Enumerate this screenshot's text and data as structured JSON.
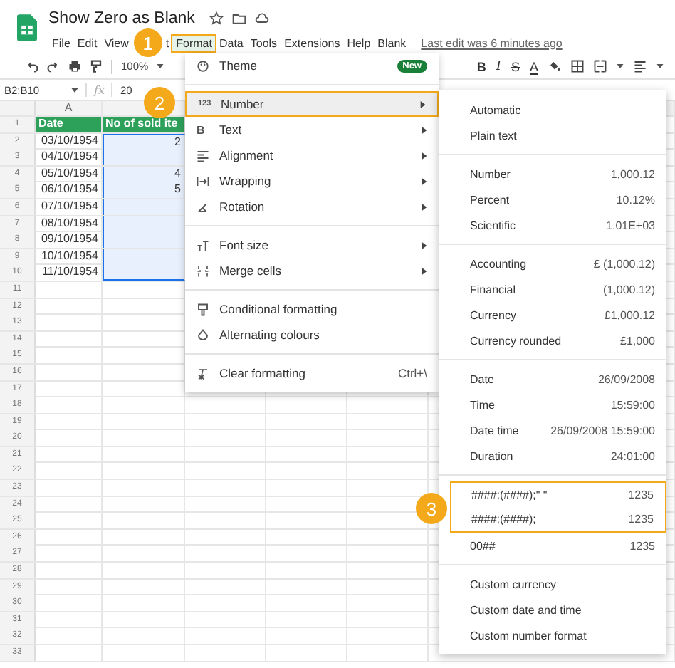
{
  "document": {
    "title": "Show Zero as Blank",
    "last_edit": "Last edit was 6 minutes ago"
  },
  "menu_bar": [
    {
      "label": "File",
      "selected": false
    },
    {
      "label": "Edit",
      "selected": false
    },
    {
      "label": "View",
      "selected": false
    },
    {
      "label": "t",
      "selected": false
    },
    {
      "label": "Format",
      "selected": true
    },
    {
      "label": "Data",
      "selected": false
    },
    {
      "label": "Tools",
      "selected": false
    },
    {
      "label": "Extensions",
      "selected": false
    },
    {
      "label": "Help",
      "selected": false
    },
    {
      "label": "Blank",
      "selected": false
    }
  ],
  "toolbar": {
    "zoom": "100%",
    "format_buttons": [
      "B",
      "I",
      "S",
      "A"
    ]
  },
  "formula_bar": {
    "range": "B2:B10",
    "fx": "fx",
    "value": "20"
  },
  "columns": [
    "A"
  ],
  "row_numbers": [
    "1",
    "2",
    "3",
    "4",
    "5",
    "6",
    "7",
    "8",
    "9",
    "10",
    "11",
    "12",
    "13",
    "14",
    "15",
    "16",
    "17",
    "18",
    "19",
    "20",
    "21",
    "22",
    "23",
    "24",
    "25",
    "26",
    "27",
    "28",
    "29",
    "30",
    "31",
    "32",
    "33"
  ],
  "rows": [
    {
      "header": true,
      "cells": [
        {
          "text": "Date",
          "selected": false
        },
        {
          "text": "No of sold ite",
          "selected": false
        }
      ]
    },
    {
      "header": false,
      "cells": [
        {
          "text": "03/10/1954",
          "selected": false
        },
        {
          "text": "2",
          "selected": true
        }
      ]
    },
    {
      "header": false,
      "cells": [
        {
          "text": "04/10/1954",
          "selected": false
        },
        {
          "selected": true
        }
      ]
    },
    {
      "header": false,
      "cells": [
        {
          "text": "05/10/1954",
          "selected": false
        },
        {
          "text": "4",
          "selected": true
        }
      ]
    },
    {
      "header": false,
      "cells": [
        {
          "text": "06/10/1954",
          "selected": false
        },
        {
          "text": "5",
          "selected": true
        }
      ]
    },
    {
      "header": false,
      "cells": [
        {
          "text": "07/10/1954",
          "selected": false
        },
        {
          "selected": true
        }
      ]
    },
    {
      "header": false,
      "cells": [
        {
          "text": "08/10/1954",
          "selected": false
        },
        {
          "selected": true
        }
      ]
    },
    {
      "header": false,
      "cells": [
        {
          "text": "09/10/1954",
          "selected": false
        },
        {
          "selected": true
        }
      ]
    },
    {
      "header": false,
      "cells": [
        {
          "text": "10/10/1954",
          "selected": false
        },
        {
          "selected": true
        }
      ]
    },
    {
      "header": false,
      "cells": [
        {
          "text": "11/10/1954",
          "selected": false
        },
        {
          "selected": true
        }
      ]
    }
  ],
  "format_menu": {
    "sections": [
      [
        {
          "label": "Theme",
          "badge": "New",
          "selected": false,
          "submenu": false
        }
      ],
      [
        {
          "label": "Number",
          "icon_text": "123",
          "selected": true,
          "submenu": true
        },
        {
          "label": "Text",
          "icon_text": "B",
          "selected": false,
          "submenu": true
        },
        {
          "label": "Alignment",
          "selected": false,
          "submenu": true
        },
        {
          "label": "Wrapping",
          "selected": false,
          "submenu": true
        },
        {
          "label": "Rotation",
          "selected": false,
          "submenu": true
        }
      ],
      [
        {
          "label": "Font size",
          "selected": false,
          "submenu": true
        },
        {
          "label": "Merge cells",
          "selected": false,
          "submenu": true
        }
      ],
      [
        {
          "label": "Conditional formatting",
          "selected": false,
          "submenu": false
        },
        {
          "label": "Alternating colours",
          "selected": false,
          "submenu": false
        }
      ],
      [
        {
          "label": "Clear formatting",
          "shortcut": "Ctrl+\\",
          "selected": false,
          "submenu": false
        }
      ]
    ]
  },
  "number_menu": {
    "sections": [
      [
        {
          "label": "Automatic",
          "highlighted": false
        },
        {
          "label": "Plain text",
          "highlighted": false
        }
      ],
      [
        {
          "label": "Number",
          "example": "1,000.12",
          "highlighted": false
        },
        {
          "label": "Percent",
          "example": "10.12%",
          "highlighted": false
        },
        {
          "label": "Scientific",
          "example": "1.01E+03",
          "highlighted": false
        }
      ],
      [
        {
          "label": "Accounting",
          "example": "£ (1,000.12)",
          "highlighted": false
        },
        {
          "label": "Financial",
          "example": "(1,000.12)",
          "highlighted": false
        },
        {
          "label": "Currency",
          "example": "£1,000.12",
          "highlighted": false
        },
        {
          "label": "Currency rounded",
          "example": "£1,000",
          "highlighted": false
        }
      ],
      [
        {
          "label": "Date",
          "example": "26/09/2008",
          "highlighted": false
        },
        {
          "label": "Time",
          "example": "15:59:00",
          "highlighted": false
        },
        {
          "label": "Date time",
          "example": "26/09/2008 15:59:00",
          "highlighted": false
        },
        {
          "label": "Duration",
          "example": "24:01:00",
          "highlighted": false
        }
      ],
      [
        {
          "label": "####;(####);\" \"",
          "example": "1235",
          "highlighted": true
        },
        {
          "label": "####;(####);",
          "example": "1235",
          "highlighted": true
        },
        {
          "label": "00##",
          "example": "1235",
          "highlighted": false
        }
      ],
      [
        {
          "label": "Custom currency",
          "highlighted": false
        },
        {
          "label": "Custom date and time",
          "highlighted": false
        },
        {
          "label": "Custom number format",
          "highlighted": false
        }
      ]
    ]
  },
  "step_markers": [
    "1",
    "2",
    "3"
  ]
}
